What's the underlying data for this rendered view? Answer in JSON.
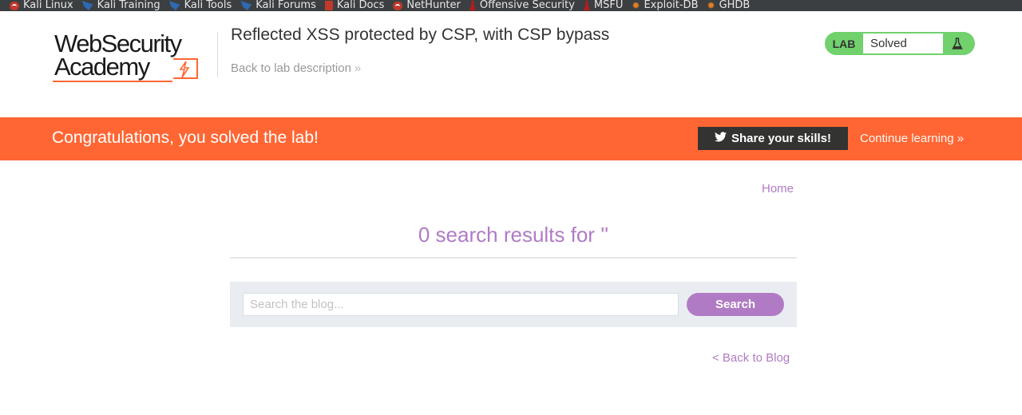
{
  "bookmarks": [
    {
      "label": "Kali Linux",
      "icon": "kali-dragon-icon"
    },
    {
      "label": "Kali Training",
      "icon": "kali-dragon-icon"
    },
    {
      "label": "Kali Tools",
      "icon": "kali-dragon-icon"
    },
    {
      "label": "Kali Forums",
      "icon": "kali-dragon-icon"
    },
    {
      "label": "Kali Docs",
      "icon": "doc-icon"
    },
    {
      "label": "NetHunter",
      "icon": "kali-dragon-icon"
    },
    {
      "label": "Offensive Security",
      "icon": "offsec-icon"
    },
    {
      "label": "MSFU",
      "icon": "offsec-icon"
    },
    {
      "label": "Exploit-DB",
      "icon": "spider-icon"
    },
    {
      "label": "GHDB",
      "icon": "spider-icon"
    }
  ],
  "header": {
    "logo_line1": "WebSecurity",
    "logo_line2": "Academy",
    "lab_title": "Reflected XSS protected by CSP, with CSP bypass",
    "back_to_description": "Back to lab description",
    "lab_badge": {
      "label": "LAB",
      "status": "Solved"
    }
  },
  "banner": {
    "message": "Congratulations, you solved the lab!",
    "share_label": "Share your skills!",
    "continue_label": "Continue learning"
  },
  "main": {
    "home_link": "Home",
    "results_title": "0 search results for ''",
    "search": {
      "placeholder": "Search the blog...",
      "value": "",
      "button_label": "Search"
    },
    "back_to_blog": "< Back to Blog"
  },
  "colors": {
    "banner": "#ff6633",
    "accent": "#b07bc4",
    "lab_badge": "#70d16d",
    "bookmarks_bar": "#3c3f41"
  }
}
